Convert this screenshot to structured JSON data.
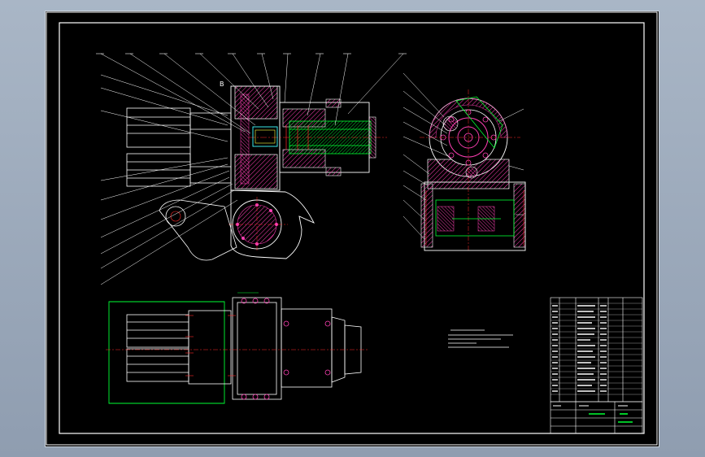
{
  "drawing": {
    "kind": "CAD assembly drawing",
    "background": "#000000",
    "section_label": "B",
    "colors": {
      "outline": "#ffffff",
      "hatch": "#ff3fb4",
      "center": "#ff2a2a",
      "green": "#00ff33",
      "cyan": "#40ffff",
      "yellow": "#ffff40"
    }
  }
}
